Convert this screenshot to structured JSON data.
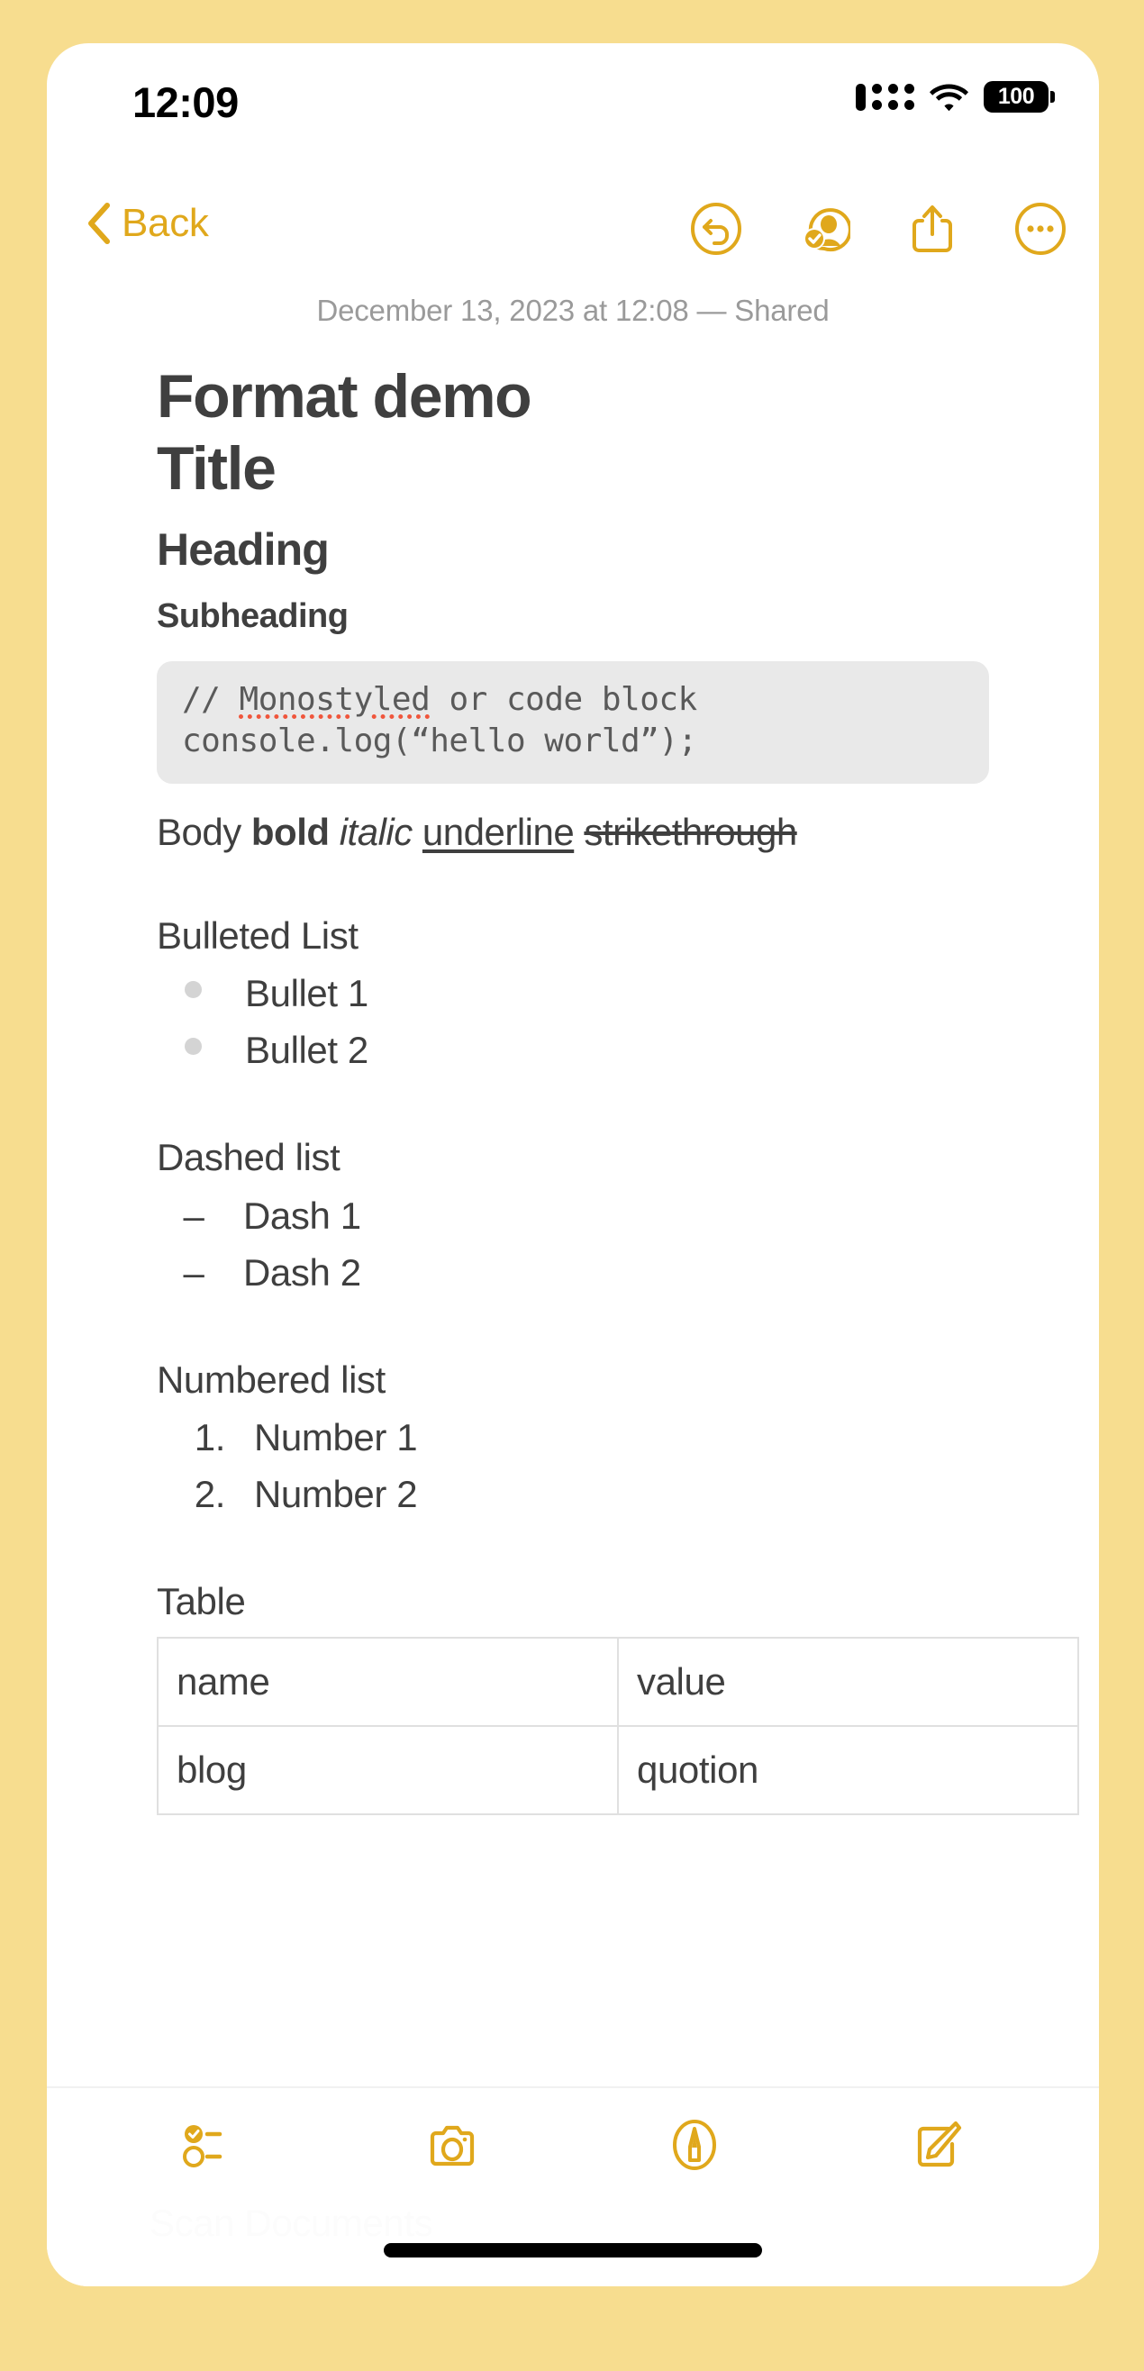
{
  "theme": {
    "page_background": "#f7dd8f",
    "accent": "#e0a81c",
    "text": "#3f3f3f",
    "muted": "#9a9a9a",
    "code_background": "#e9e9e9",
    "spellcheck": "#f0563c",
    "bullet": "#d4d4d4"
  },
  "status_bar": {
    "time": "12:09",
    "signal_icon": "cellular-signal-icon",
    "wifi_icon": "wifi-icon",
    "battery_level": "100",
    "battery_icon": "battery-icon"
  },
  "nav": {
    "back_label": "Back",
    "back_icon": "chevron-left-icon",
    "actions": [
      {
        "name": "undo-button",
        "icon": "undo-circle-icon"
      },
      {
        "name": "collaborators-button",
        "icon": "person-check-circle-icon"
      },
      {
        "name": "share-button",
        "icon": "share-up-arrow-icon"
      },
      {
        "name": "more-button",
        "icon": "ellipsis-circle-icon"
      }
    ]
  },
  "note": {
    "date_line": "December 13, 2023 at 12:08 — Shared",
    "title_big": "Format demo",
    "title": "Title",
    "heading": "Heading",
    "subheading": "Subheading",
    "code_block": {
      "comment_prefix": "// ",
      "misspelled_word": "Monostyled",
      "comment_rest": " or code block",
      "line2": "console.log(“hello world”);"
    },
    "format_line": {
      "body": "Body ",
      "bold": "bold",
      "italic": "italic",
      "underline": "underline",
      "strikethrough": "strikethrough"
    },
    "bulleted": {
      "label": "Bulleted List",
      "items": [
        "Bullet 1",
        "Bullet 2"
      ]
    },
    "dashed": {
      "label": "Dashed list",
      "marker": "–",
      "items": [
        "Dash 1",
        "Dash 2"
      ]
    },
    "numbered": {
      "label": "Numbered list",
      "items": [
        {
          "marker": "1.",
          "text": "Number 1"
        },
        {
          "marker": "2.",
          "text": "Number 2"
        }
      ]
    },
    "table": {
      "label": "Table",
      "rows": [
        [
          "name",
          "value"
        ],
        [
          "blog",
          "quotion"
        ]
      ]
    }
  },
  "bottom_bar": {
    "ghost_label": "Scan Documents",
    "actions": [
      {
        "name": "checklist-button",
        "icon": "checklist-icon"
      },
      {
        "name": "camera-button",
        "icon": "camera-icon"
      },
      {
        "name": "markup-button",
        "icon": "pen-circle-icon"
      },
      {
        "name": "compose-button",
        "icon": "compose-pencil-icon"
      }
    ]
  }
}
